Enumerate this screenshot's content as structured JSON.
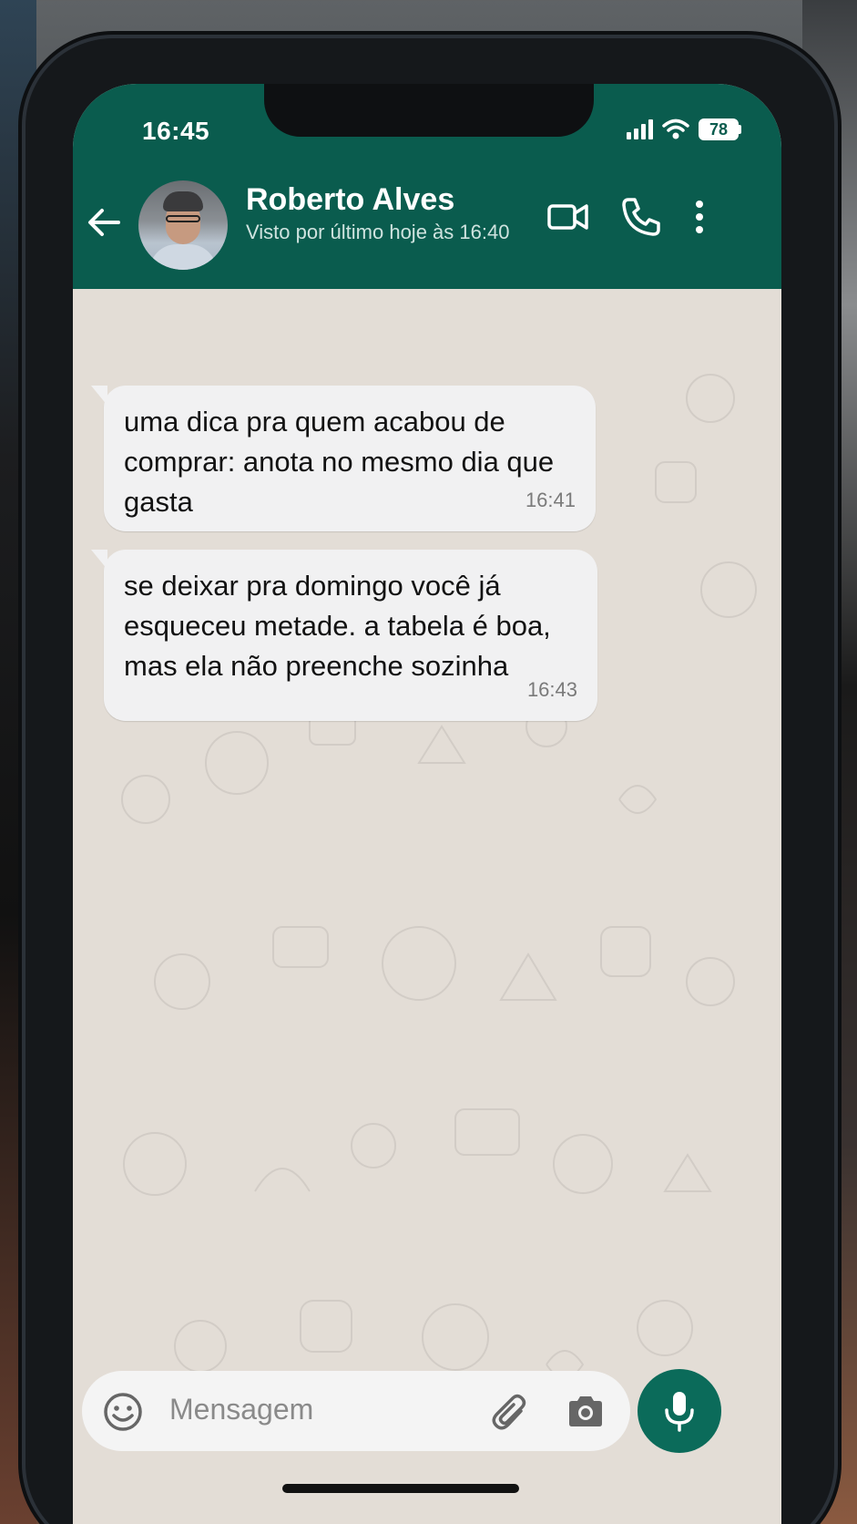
{
  "status_bar": {
    "time": "16:45",
    "battery": "78"
  },
  "header": {
    "contact_name": "Roberto Alves",
    "contact_status": "Visto por último hoje às 16:40"
  },
  "messages": [
    {
      "text": "uma dica pra quem acabou de comprar: anota no mesmo dia que gasta",
      "time": "16:41"
    },
    {
      "text": "se deixar pra domingo você já esqueceu metade. a tabela é boa, mas ela não preenche sozinha",
      "time": "16:43"
    }
  ],
  "composer": {
    "placeholder": "Mensagem"
  },
  "colors": {
    "header": "#0a5c4e",
    "chat_bg": "#e3ddd6",
    "bubble": "#f1f1f2",
    "mic_button": "#0b6b5a"
  },
  "icons": [
    "back-arrow-icon",
    "video-call-icon",
    "phone-call-icon",
    "more-options-icon",
    "emoji-icon",
    "attach-icon",
    "camera-icon",
    "microphone-icon",
    "signal-icon",
    "wifi-icon",
    "battery-icon"
  ]
}
